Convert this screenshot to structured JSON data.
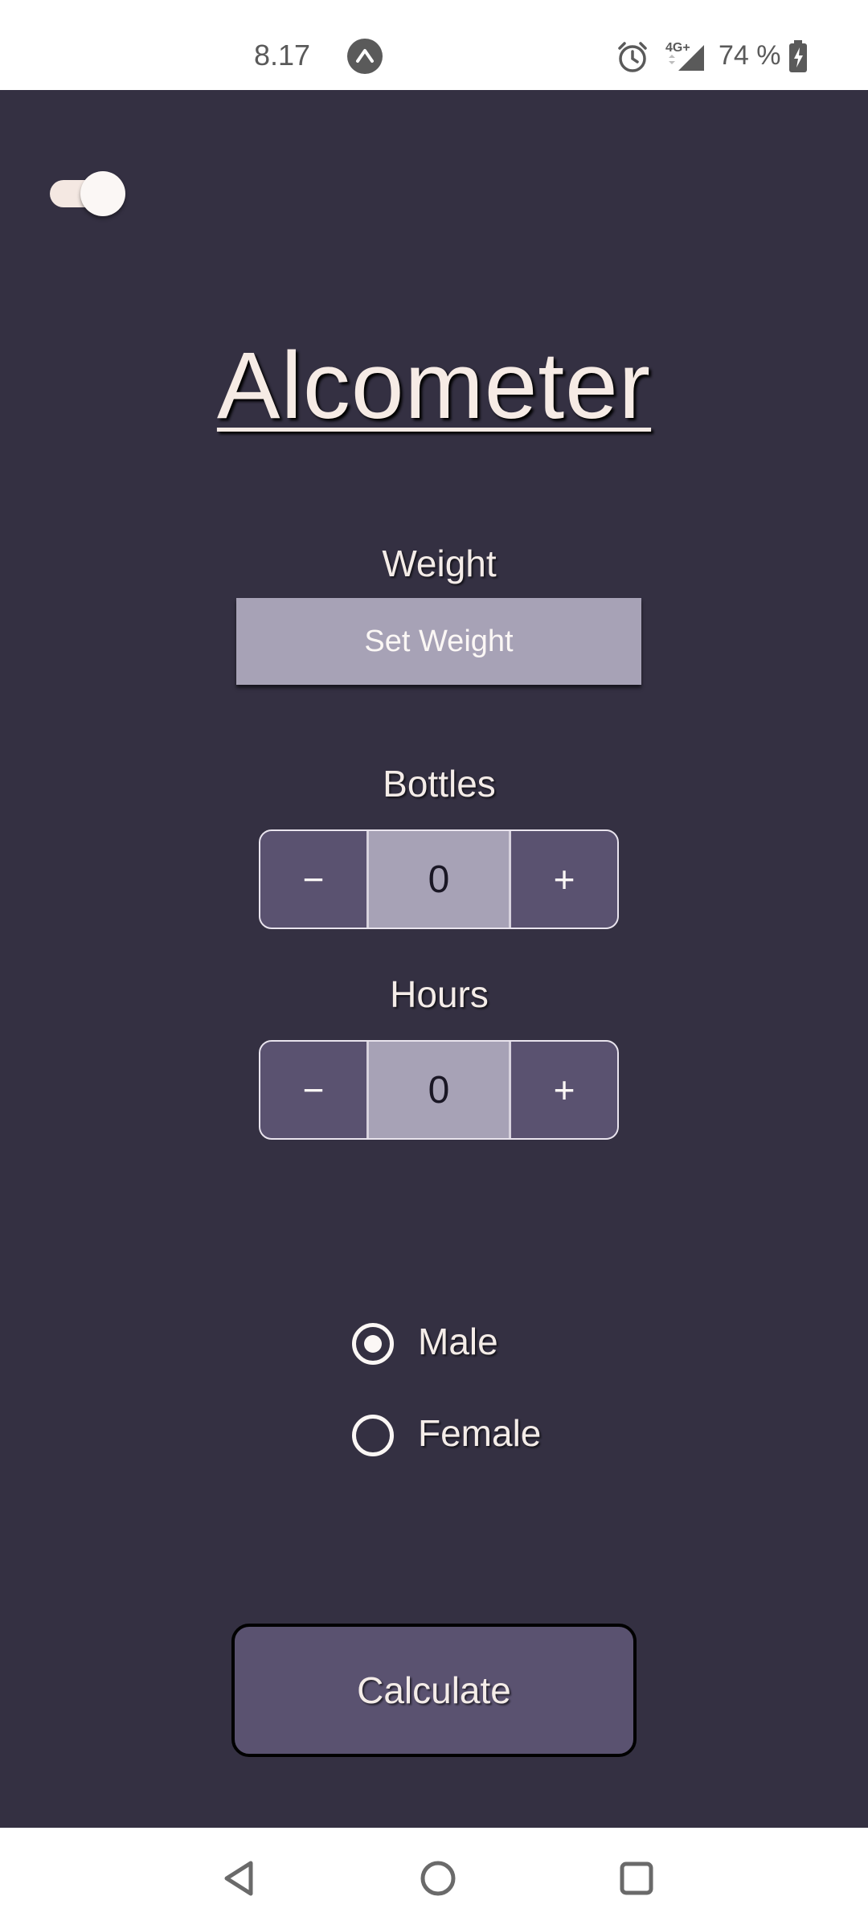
{
  "status_bar": {
    "time": "8.17",
    "network": "4G+",
    "battery": "74 %",
    "icons": [
      "app-notification-icon",
      "alarm-icon",
      "signal-icon",
      "battery-charging-icon"
    ]
  },
  "app": {
    "title": "Alcometer",
    "theme_toggle": {
      "on": true
    },
    "weight": {
      "label": "Weight",
      "button_label": "Set Weight"
    },
    "bottles": {
      "label": "Bottles",
      "value": "0",
      "minus": "−",
      "plus": "+"
    },
    "hours": {
      "label": "Hours",
      "value": "0",
      "minus": "−",
      "plus": "+"
    },
    "gender": {
      "options": [
        {
          "label": "Male",
          "selected": true
        },
        {
          "label": "Female",
          "selected": false
        }
      ]
    },
    "calculate_label": "Calculate"
  },
  "nav_bar": {
    "icons": [
      "back-icon",
      "home-icon",
      "recents-icon"
    ]
  },
  "colors": {
    "background": "#343042",
    "primary": "#5a5270",
    "secondary": "#a7a2b6",
    "text": "#f4ece8"
  }
}
